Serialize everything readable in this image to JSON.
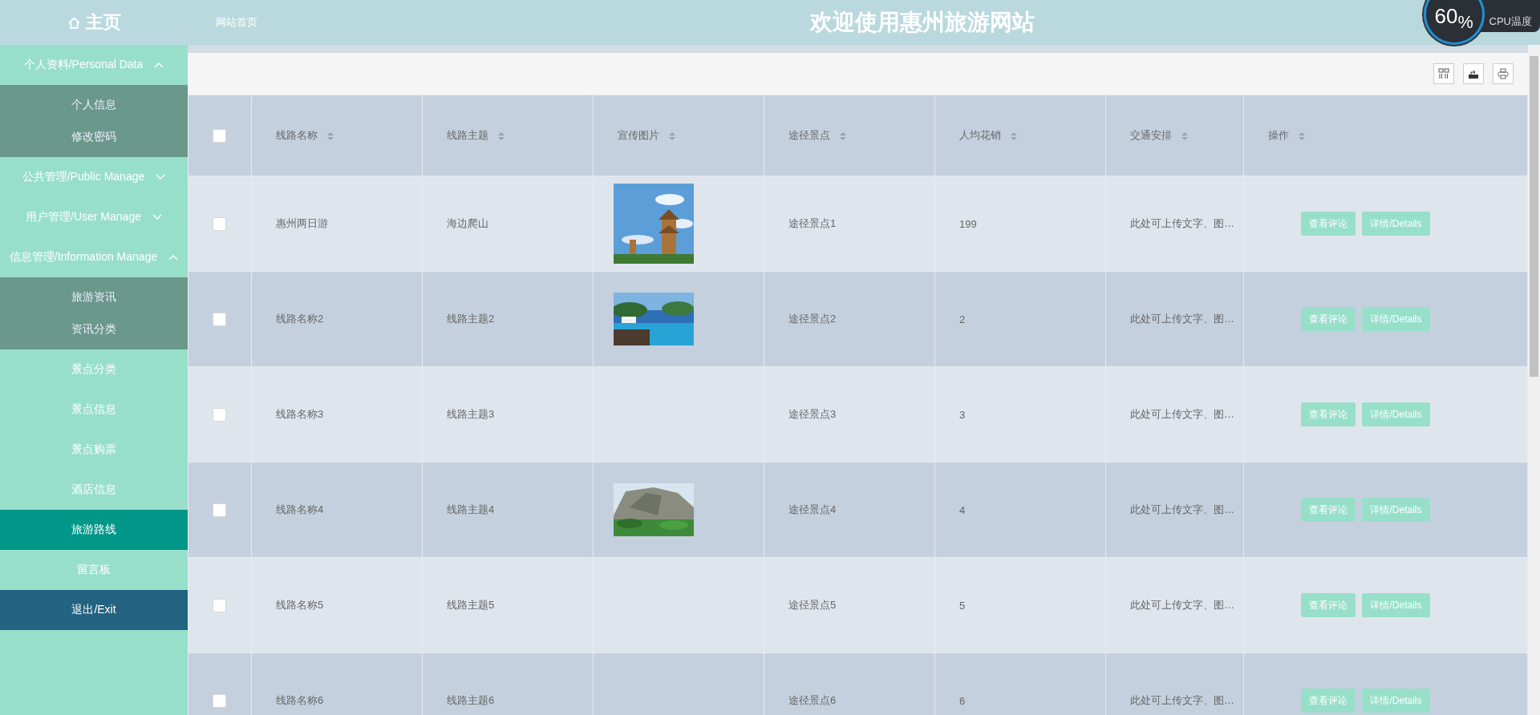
{
  "header": {
    "home": "主页",
    "nav_link": "网站首页",
    "title": "欢迎使用惠州旅游网站"
  },
  "cpu_widget": {
    "percent": "60$_{%}$",
    "label": "CPU温度"
  },
  "sidebar": {
    "items": [
      {
        "kind": "group",
        "label": "个人资料/Personal Data",
        "expanded": true,
        "children": [
          {
            "label": "个人信息",
            "selected": false
          },
          {
            "label": "修改密码",
            "selected": false
          }
        ]
      },
      {
        "kind": "group",
        "label": "公共管理/Public Manage",
        "expanded": false
      },
      {
        "kind": "group",
        "label": "用户管理/User Manage",
        "expanded": false
      },
      {
        "kind": "group",
        "label": "信息管理/Information Manage",
        "expanded": true,
        "children": [
          {
            "label": "旅游资讯",
            "selected": false
          },
          {
            "label": "资讯分类",
            "selected": false
          }
        ]
      },
      {
        "kind": "item",
        "label": "景点分类",
        "selected": false
      },
      {
        "kind": "item",
        "label": "景点信息",
        "selected": false
      },
      {
        "kind": "item",
        "label": "景点购票",
        "selected": false
      },
      {
        "kind": "item",
        "label": "酒店信息",
        "selected": false
      },
      {
        "kind": "item",
        "label": "旅游路线",
        "selected": true
      },
      {
        "kind": "item",
        "label": "留言板",
        "selected": false
      },
      {
        "kind": "exit",
        "label": "退出/Exit",
        "selected": false
      }
    ]
  },
  "table": {
    "select_all": {
      "checked": false
    },
    "columns": [
      "线路名称",
      "线路主题",
      "宣传图片",
      "途径景点",
      "人均花销",
      "交通安排",
      "操作"
    ],
    "rows": [
      {
        "checked": false,
        "name": "惠州两日游",
        "theme": "海边爬山",
        "spots": "途径景点1",
        "cost": "199",
        "transport": "此处可上传文字、图…",
        "actions": [
          "查看评论",
          "详情/Details"
        ]
      },
      {
        "checked": false,
        "name": "线路名称2",
        "theme": "线路主题2",
        "spots": "途径景点2",
        "cost": "2",
        "transport": "此处可上传文字、图…",
        "actions": [
          "查看评论",
          "详情/Details"
        ]
      },
      {
        "checked": false,
        "name": "线路名称3",
        "theme": "线路主题3",
        "spots": "途径景点3",
        "cost": "3",
        "transport": "此处可上传文字、图…",
        "actions": [
          "查看评论",
          "详情/Details"
        ]
      },
      {
        "checked": false,
        "name": "线路名称4",
        "theme": "线路主题4",
        "spots": "途径景点4",
        "cost": "4",
        "transport": "此处可上传文字、图…",
        "actions": [
          "查看评论",
          "详情/Details"
        ]
      },
      {
        "checked": false,
        "name": "线路名称5",
        "theme": "线路主题5",
        "spots": "途径景点5",
        "cost": "5",
        "transport": "此处可上传文字、图…",
        "actions": [
          "查看评论",
          "详情/Details"
        ]
      },
      {
        "checked": false,
        "name": "线路名称6",
        "theme": "线路主题6",
        "spots": "途径景点6",
        "cost": "6",
        "transport": "此处可上传文字、图…",
        "actions": [
          "查看评论",
          "详情/Details"
        ]
      }
    ]
  }
}
